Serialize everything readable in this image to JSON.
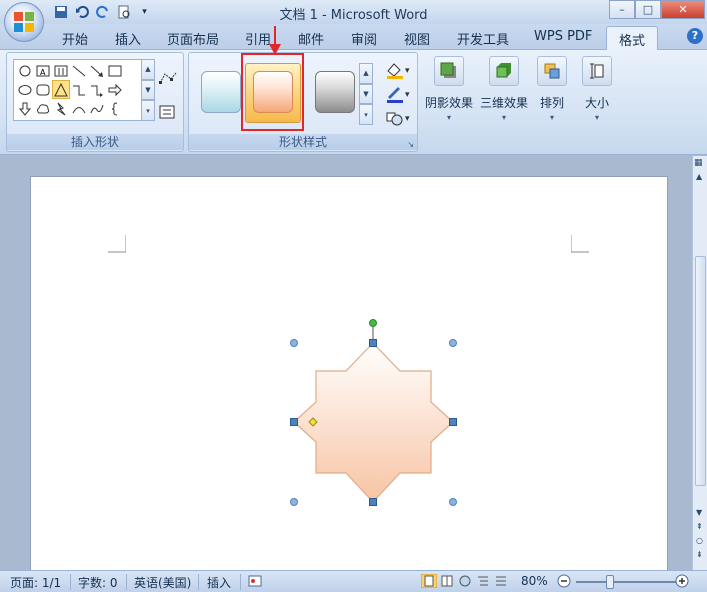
{
  "window": {
    "title": "文档 1 - Microsoft Word",
    "controls": {
      "minimize": "–",
      "maximize": "□",
      "close": "✕"
    }
  },
  "tabs": [
    "开始",
    "插入",
    "页面布局",
    "引用",
    "邮件",
    "审阅",
    "视图",
    "开发工具",
    "WPS PDF",
    "格式"
  ],
  "active_tab": "格式",
  "ribbon": {
    "groups": {
      "insert_shapes": {
        "label": "插入形状"
      },
      "shape_styles": {
        "label": "形状样式"
      }
    },
    "buttons": {
      "shadow": "阴影效果",
      "threed": "三维效果",
      "arrange": "排列",
      "size": "大小"
    }
  },
  "status": {
    "page": "页面: 1/1",
    "words": "字数: 0",
    "language": "英语(美国)",
    "mode": "插入",
    "zoom": "80%"
  },
  "colors": {
    "shape_fill_top": "#ffffff",
    "shape_fill_bottom": "#f7c4a4",
    "highlight": "#e4262b",
    "handle": "#4f81bd",
    "rotate_handle": "#3fbf3f"
  }
}
